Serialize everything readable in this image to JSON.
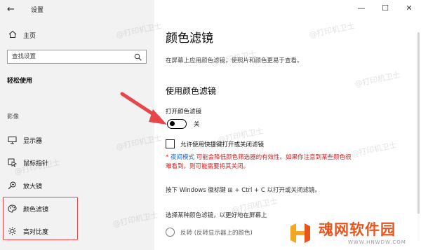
{
  "window": {
    "back_glyph": "←",
    "title": "设置",
    "controls": [
      "—",
      "☐",
      "✕"
    ]
  },
  "sidebar": {
    "home_label": "主页",
    "search_placeholder": "查找设置",
    "section_heading": "轻松使用",
    "group_label": "影像",
    "items": [
      {
        "label": "显示器",
        "icon": "monitor-icon"
      },
      {
        "label": "鼠标指针",
        "icon": "mouse-pointer-icon"
      },
      {
        "label": "放大镜",
        "icon": "magnifier-icon"
      },
      {
        "label": "颜色滤镜",
        "icon": "color-palette-icon"
      },
      {
        "label": "高对比度",
        "icon": "contrast-sun-icon"
      }
    ]
  },
  "main": {
    "title": "颜色滤镜",
    "subtitle": "在屏幕上应用颜色滤镜，使照片和颜色更易于查看。",
    "section_heading": "使用颜色滤镜",
    "toggle_caption": "打开颜色滤镜",
    "toggle_state": "关",
    "toggle_on": false,
    "shortcut_checkbox_label": "允许使用快捷键打开或关闭滤镜",
    "shortcut_checked": false,
    "warning_prefix": "* ",
    "warning_link": "夜间模式",
    "warning_text_line1": " 可能会降低颜色筛选器的有效性。如果你注意到某些颜色很",
    "warning_text_line2": "难看到，则可能需要将其关闭。",
    "shortcut_tip": "按下 Windows 徽标键 ⊞ + Ctrl + C 以打开或关闭滤镜。",
    "choose_filter": "选择某种颜色滤镜，以更好地在屏幕上",
    "radio_label": "反转 (反转显示器上的颜色)"
  },
  "overlay": {
    "watermark_text": "@打印机卫士",
    "logo_text": "魂网软件园",
    "logo_url": "WWW.HNWDW.COM",
    "highlight_color": "#e8474a",
    "arrow_color": "#e8474a"
  }
}
